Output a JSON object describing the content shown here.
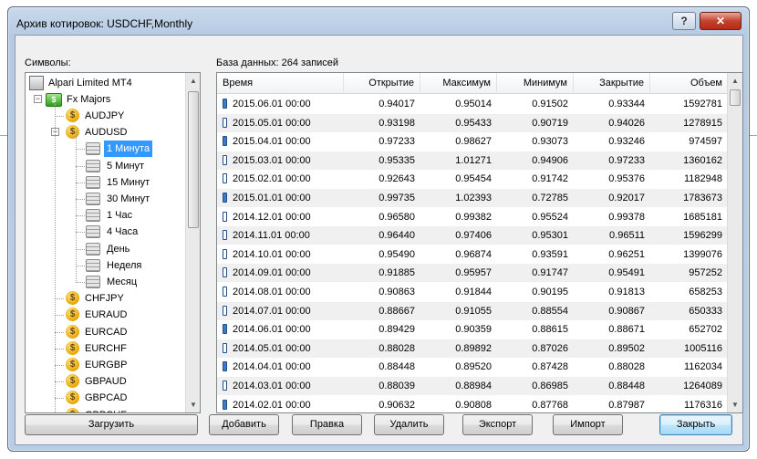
{
  "window": {
    "title": "Архив котировок: USDCHF,Monthly",
    "help_label": "?",
    "close_icon": "close-icon"
  },
  "symbols_label": "Символы:",
  "db_label": "База данных: 264 записей",
  "tree": {
    "root": "Alpari Limited MT4",
    "group": "Fx Majors",
    "items": [
      {
        "label": "AUDJPY",
        "type": "symbol",
        "level": 2
      },
      {
        "label": "AUDUSD",
        "type": "symbol",
        "level": 2,
        "expanded": true
      },
      {
        "label": "1 Минута",
        "type": "period",
        "level": 3,
        "selected": true
      },
      {
        "label": "5 Минут",
        "type": "period",
        "level": 3
      },
      {
        "label": "15 Минут",
        "type": "period",
        "level": 3
      },
      {
        "label": "30 Минут",
        "type": "period",
        "level": 3
      },
      {
        "label": "1 Час",
        "type": "period",
        "level": 3
      },
      {
        "label": "4 Часа",
        "type": "period",
        "level": 3
      },
      {
        "label": "День",
        "type": "period",
        "level": 3
      },
      {
        "label": "Неделя",
        "type": "period",
        "level": 3
      },
      {
        "label": "Месяц",
        "type": "period",
        "level": 3
      },
      {
        "label": "CHFJPY",
        "type": "symbol",
        "level": 2
      },
      {
        "label": "EURAUD",
        "type": "symbol",
        "level": 2
      },
      {
        "label": "EURCAD",
        "type": "symbol",
        "level": 2
      },
      {
        "label": "EURCHF",
        "type": "symbol",
        "level": 2
      },
      {
        "label": "EURGBP",
        "type": "symbol",
        "level": 2
      },
      {
        "label": "GBPAUD",
        "type": "symbol",
        "level": 2
      },
      {
        "label": "GBPCAD",
        "type": "symbol",
        "level": 2
      },
      {
        "label": "GBPCHF",
        "type": "symbol",
        "level": 2
      }
    ]
  },
  "table": {
    "columns": [
      "Время",
      "Открытие",
      "Максимум",
      "Минимум",
      "Закрытие",
      "Объем"
    ],
    "rows": [
      {
        "time": "2015.06.01 00:00",
        "open": "0.94017",
        "high": "0.95014",
        "low": "0.91502",
        "close": "0.93344",
        "volume": "1592781",
        "candle": "bear"
      },
      {
        "time": "2015.05.01 00:00",
        "open": "0.93198",
        "high": "0.95433",
        "low": "0.90719",
        "close": "0.94026",
        "volume": "1278915",
        "candle": "bull"
      },
      {
        "time": "2015.04.01 00:00",
        "open": "0.97233",
        "high": "0.98627",
        "low": "0.93073",
        "close": "0.93246",
        "volume": "974597",
        "candle": "bear"
      },
      {
        "time": "2015.03.01 00:00",
        "open": "0.95335",
        "high": "1.01271",
        "low": "0.94906",
        "close": "0.97233",
        "volume": "1360162",
        "candle": "bull"
      },
      {
        "time": "2015.02.01 00:00",
        "open": "0.92643",
        "high": "0.95454",
        "low": "0.91742",
        "close": "0.95376",
        "volume": "1182948",
        "candle": "bull"
      },
      {
        "time": "2015.01.01 00:00",
        "open": "0.99735",
        "high": "1.02393",
        "low": "0.72785",
        "close": "0.92017",
        "volume": "1783673",
        "candle": "bear"
      },
      {
        "time": "2014.12.01 00:00",
        "open": "0.96580",
        "high": "0.99382",
        "low": "0.95524",
        "close": "0.99378",
        "volume": "1685181",
        "candle": "bull"
      },
      {
        "time": "2014.11.01 00:00",
        "open": "0.96440",
        "high": "0.97406",
        "low": "0.95301",
        "close": "0.96511",
        "volume": "1596299",
        "candle": "bull"
      },
      {
        "time": "2014.10.01 00:00",
        "open": "0.95490",
        "high": "0.96874",
        "low": "0.93591",
        "close": "0.96251",
        "volume": "1399076",
        "candle": "bull"
      },
      {
        "time": "2014.09.01 00:00",
        "open": "0.91885",
        "high": "0.95957",
        "low": "0.91747",
        "close": "0.95491",
        "volume": "957252",
        "candle": "bull"
      },
      {
        "time": "2014.08.01 00:00",
        "open": "0.90863",
        "high": "0.91844",
        "low": "0.90195",
        "close": "0.91813",
        "volume": "658253",
        "candle": "bull"
      },
      {
        "time": "2014.07.01 00:00",
        "open": "0.88667",
        "high": "0.91055",
        "low": "0.88554",
        "close": "0.90867",
        "volume": "650333",
        "candle": "bull"
      },
      {
        "time": "2014.06.01 00:00",
        "open": "0.89429",
        "high": "0.90359",
        "low": "0.88615",
        "close": "0.88671",
        "volume": "652702",
        "candle": "bear"
      },
      {
        "time": "2014.05.01 00:00",
        "open": "0.88028",
        "high": "0.89892",
        "low": "0.87026",
        "close": "0.89502",
        "volume": "1005116",
        "candle": "bull"
      },
      {
        "time": "2014.04.01 00:00",
        "open": "0.88448",
        "high": "0.89520",
        "low": "0.87428",
        "close": "0.88028",
        "volume": "1162034",
        "candle": "bear"
      },
      {
        "time": "2014.03.01 00:00",
        "open": "0.88039",
        "high": "0.88984",
        "low": "0.86985",
        "close": "0.88448",
        "volume": "1264089",
        "candle": "bull"
      },
      {
        "time": "2014.02.01 00:00",
        "open": "0.90632",
        "high": "0.90808",
        "low": "0.87768",
        "close": "0.87987",
        "volume": "1176316",
        "candle": "bear"
      }
    ]
  },
  "buttons": {
    "load": "Загрузить",
    "add": "Добавить",
    "edit": "Правка",
    "delete": "Удалить",
    "export": "Экспорт",
    "import": "Импорт",
    "close": "Закрыть"
  },
  "colors": {
    "selection": "#3399ff",
    "bear_candle": "#3d7bc8",
    "accent_close": "#c4432f"
  }
}
